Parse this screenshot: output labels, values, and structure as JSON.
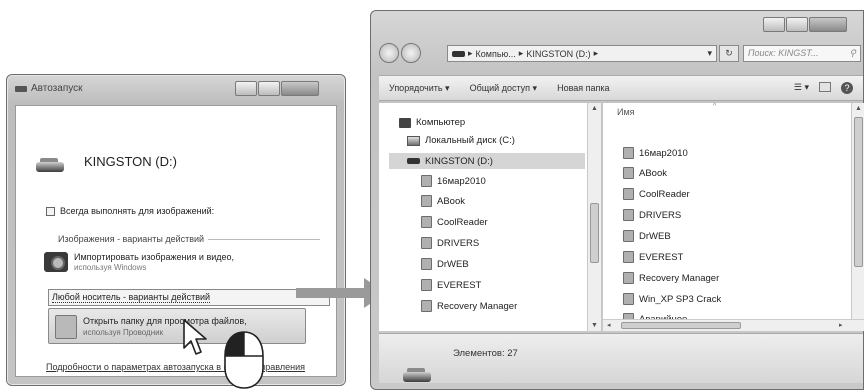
{
  "autoplay": {
    "title": "Автозапуск",
    "drive_name": "KINGSTON (D:)",
    "always_checkbox": "Всегда выполнять для изображений:",
    "section_header": "Изображения - варианты действий",
    "import_title": "Импортировать изображения и видео,",
    "import_sub": "используя Windows",
    "general_options": "Любой носитель - варианты действий",
    "open_folder_title": "Открыть папку для просмотра файлов,",
    "open_folder_sub": "используя Проводник",
    "more_link": "Подробности о параметрах автозапуска в панели управления"
  },
  "explorer": {
    "address": {
      "crumb1": "Компью...",
      "crumb2": "KINGSTON (D:)",
      "sep": "▸"
    },
    "search_placeholder": "Поиск: KINGST...",
    "toolbar": {
      "organize": "Упорядочить ▾",
      "share": "Общий доступ ▾",
      "new_folder": "Новая папка"
    },
    "tree": {
      "computer": "Компьютер",
      "local_disk": "Локальный диск (C:)",
      "kingston": "KINGSTON (D:)",
      "folders": [
        "16мар2010",
        "ABook",
        "CoolReader",
        "DRIVERS",
        "DrWEB",
        "EVEREST",
        "Recovery Manager"
      ]
    },
    "column_name": "Имя",
    "files": [
      "16мар2010",
      "ABook",
      "CoolReader",
      "DRIVERS",
      "DrWEB",
      "EVEREST",
      "Recovery Manager",
      "Win_XP SP3 Crack",
      "Аварийное"
    ],
    "status": "Элементов: 27"
  },
  "icons": [
    "removable-drive-icon",
    "camera-icon",
    "folder-icon",
    "computer-icon",
    "hard-disk-icon",
    "mouse-icon",
    "cursor-icon",
    "arrow-icon"
  ]
}
